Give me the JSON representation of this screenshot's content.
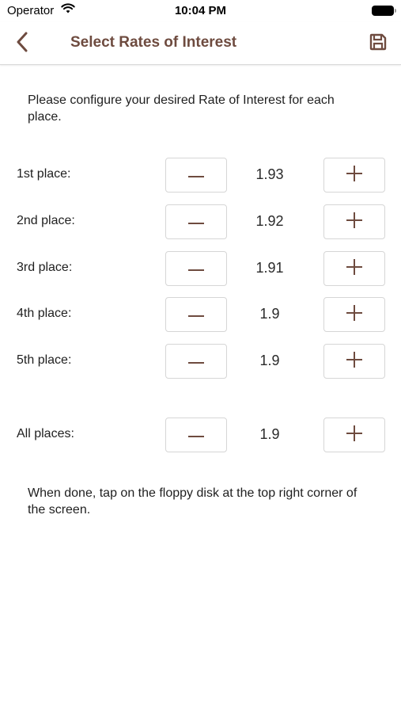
{
  "status": {
    "carrier": "Operator",
    "time": "10:04 PM"
  },
  "nav": {
    "title": "Select Rates of Interest"
  },
  "intro": "Please configure your desired Rate of Interest for each place.",
  "rows": [
    {
      "label": "1st place:",
      "value": "1.93"
    },
    {
      "label": "2nd place:",
      "value": "1.92"
    },
    {
      "label": "3rd place:",
      "value": "1.91"
    },
    {
      "label": "4th place:",
      "value": "1.9"
    },
    {
      "label": "5th place:",
      "value": "1.9"
    },
    {
      "label": "All places:",
      "value": "1.9"
    }
  ],
  "outro": "When done, tap on the floppy disk at the top right corner of the screen.",
  "icons": {
    "back": "chevron-left-icon",
    "save": "floppy-disk-icon",
    "minus": "minus-icon",
    "plus": "plus-icon"
  },
  "colors": {
    "accent": "#6e4b3f",
    "border": "#d6d6d6"
  }
}
